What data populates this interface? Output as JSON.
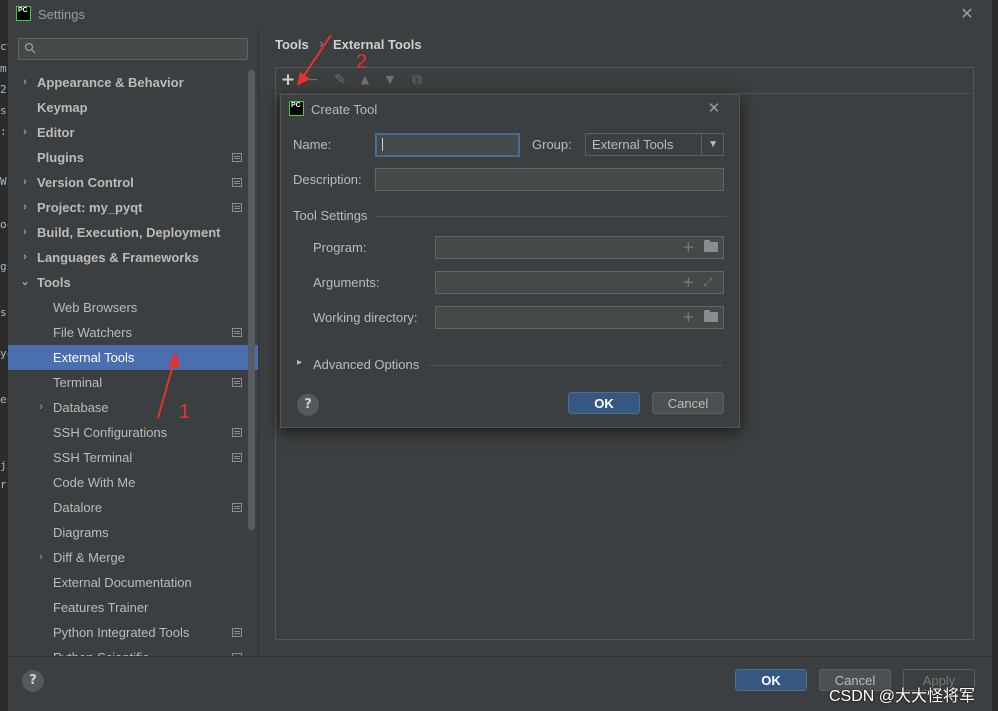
{
  "window": {
    "title": "Settings",
    "close_glyph": "✕"
  },
  "background_chars": [
    "ct",
    "m",
    "2",
    "s",
    ":",
    "W",
    "oc",
    "gs",
    "s",
    "yc",
    "es",
    "ji",
    "r"
  ],
  "sidebar": {
    "search_placeholder": "",
    "items": [
      {
        "label": "Appearance & Behavior",
        "bold": true,
        "chevron": "›",
        "level": 0,
        "proj": false
      },
      {
        "label": "Keymap",
        "bold": true,
        "chevron": "",
        "level": 0,
        "proj": false
      },
      {
        "label": "Editor",
        "bold": true,
        "chevron": "›",
        "level": 0,
        "proj": false
      },
      {
        "label": "Plugins",
        "bold": true,
        "chevron": "",
        "level": 0,
        "proj": true
      },
      {
        "label": "Version Control",
        "bold": true,
        "chevron": "›",
        "level": 0,
        "proj": true
      },
      {
        "label": "Project: my_pyqt",
        "bold": true,
        "chevron": "›",
        "level": 0,
        "proj": true
      },
      {
        "label": "Build, Execution, Deployment",
        "bold": true,
        "chevron": "›",
        "level": 0,
        "proj": false
      },
      {
        "label": "Languages & Frameworks",
        "bold": true,
        "chevron": "›",
        "level": 0,
        "proj": false
      },
      {
        "label": "Tools",
        "bold": true,
        "chevron": "⌄",
        "level": 0,
        "proj": false
      },
      {
        "label": "Web Browsers",
        "bold": false,
        "chevron": "",
        "level": 1,
        "proj": false
      },
      {
        "label": "File Watchers",
        "bold": false,
        "chevron": "",
        "level": 1,
        "proj": true
      },
      {
        "label": "External Tools",
        "bold": false,
        "chevron": "",
        "level": 1,
        "proj": false,
        "selected": true
      },
      {
        "label": "Terminal",
        "bold": false,
        "chevron": "",
        "level": 1,
        "proj": true
      },
      {
        "label": "Database",
        "bold": false,
        "chevron": "›",
        "level": 1,
        "proj": false
      },
      {
        "label": "SSH Configurations",
        "bold": false,
        "chevron": "",
        "level": 1,
        "proj": true
      },
      {
        "label": "SSH Terminal",
        "bold": false,
        "chevron": "",
        "level": 1,
        "proj": true
      },
      {
        "label": "Code With Me",
        "bold": false,
        "chevron": "",
        "level": 1,
        "proj": false
      },
      {
        "label": "Datalore",
        "bold": false,
        "chevron": "",
        "level": 1,
        "proj": true
      },
      {
        "label": "Diagrams",
        "bold": false,
        "chevron": "",
        "level": 1,
        "proj": false
      },
      {
        "label": "Diff & Merge",
        "bold": false,
        "chevron": "›",
        "level": 1,
        "proj": false
      },
      {
        "label": "External Documentation",
        "bold": false,
        "chevron": "",
        "level": 1,
        "proj": false
      },
      {
        "label": "Features Trainer",
        "bold": false,
        "chevron": "",
        "level": 1,
        "proj": false
      },
      {
        "label": "Python Integrated Tools",
        "bold": false,
        "chevron": "",
        "level": 1,
        "proj": true
      },
      {
        "label": "Python Scientific",
        "bold": false,
        "chevron": "",
        "level": 1,
        "proj": true
      }
    ]
  },
  "breadcrumb": {
    "parent": "Tools",
    "separator": "›",
    "current": "External Tools"
  },
  "toolbar": {
    "add": "+",
    "remove": "−",
    "edit": "✎",
    "up": "▲",
    "down": "▼",
    "copy": "⧉"
  },
  "dialog": {
    "title": "Create Tool",
    "close_glyph": "✕",
    "name_label": "Name:",
    "name_value": "",
    "group_label": "Group:",
    "group_value": "External Tools",
    "description_label": "Description:",
    "description_value": "",
    "tool_settings_label": "Tool Settings",
    "program_label": "Program:",
    "arguments_label": "Arguments:",
    "working_dir_label": "Working directory:",
    "advanced_label": "Advanced Options",
    "advanced_chevron": "▸",
    "ok_label": "OK",
    "cancel_label": "Cancel",
    "help_glyph": "?"
  },
  "footer": {
    "help_glyph": "?",
    "ok_label": "OK",
    "cancel_label": "Cancel",
    "apply_label": "Apply"
  },
  "annotations": {
    "step1": "1",
    "step2": "2",
    "color": "#e8312f"
  },
  "watermark": "CSDN @大大怪将军",
  "colors": {
    "selection": "#4b6eaf",
    "primary_button": "#365880",
    "background": "#3c3f41"
  }
}
